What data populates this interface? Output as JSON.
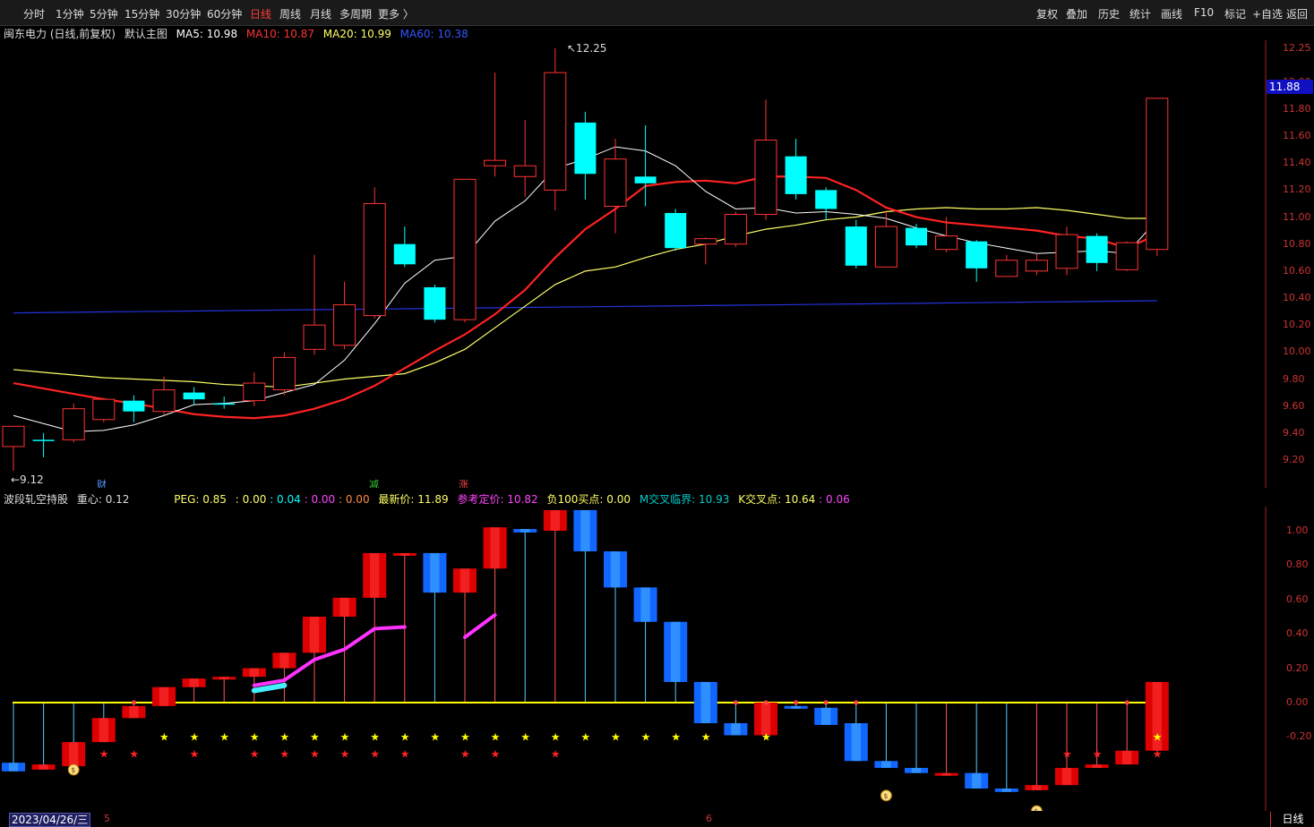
{
  "toolbar": {
    "left_items": [
      "分时",
      "1分钟",
      "5分钟",
      "15分钟",
      "30分钟",
      "60分钟",
      "日线",
      "周线",
      "月线",
      "多周期",
      "更多 〉"
    ],
    "active": "日线",
    "right_items": [
      "复权",
      "叠加",
      "历史",
      "统计",
      "画线",
      "F10",
      "标记",
      "+自选",
      "返回"
    ]
  },
  "main_header": {
    "stock": "闽东电力 (日线,前复权)",
    "template": "默认主图",
    "ma5": "MA5: 10.98",
    "ma10": "MA10: 10.87",
    "ma20": "MA20: 10.99",
    "ma60": "MA60: 10.38"
  },
  "main_axis": [
    "12.25",
    "12.00",
    "11.80",
    "11.60",
    "11.40",
    "11.20",
    "11.00",
    "10.80",
    "10.60",
    "10.40",
    "10.20",
    "10.00",
    "9.80",
    "9.60",
    "9.40",
    "9.20"
  ],
  "price_badge": "11.88",
  "high_label": "12.25",
  "low_label": "9.12",
  "event_marks": [
    "财",
    "减",
    "涨"
  ],
  "sub_header": {
    "name": "波段轧空持股",
    "center": "重心: 0.12",
    "peg": "PEG: 0.85",
    "v1": ": 0.00",
    "v2": ": 0.04",
    "v3": ": 0.00",
    "v4": ": 0.00",
    "latest": "最新价: 11.89",
    "ref": "参考定价: 10.82",
    "neg100": "负100买点: 0.00",
    "m_cross": "M交叉临界: 10.93",
    "k_cross": "K交叉点: 10.64",
    "k_cross2": ": 0.06"
  },
  "sub_axis": [
    "1.00",
    "0.80",
    "0.60",
    "0.40",
    "0.20",
    "0.00",
    "-0.20"
  ],
  "date_label": "2023/04/26/三",
  "month_ticks": [
    "5",
    "6"
  ],
  "period": "日线",
  "colors": {
    "up": "#ff3333",
    "down": "#00ffff",
    "ma5": "#ffffff",
    "ma10": "#ff2222",
    "ma20": "#ffff66",
    "ma60": "#3333ff",
    "accent": "#ff3b3b"
  },
  "chart_data": {
    "type": "candlestick",
    "ylim": [
      9.0,
      12.3
    ],
    "candles": [
      {
        "o": 9.3,
        "h": 9.38,
        "l": 9.12,
        "c": 9.45,
        "up": true
      },
      {
        "o": 9.35,
        "h": 9.4,
        "l": 9.22,
        "c": 9.35,
        "up": false
      },
      {
        "o": 9.35,
        "h": 9.62,
        "l": 9.33,
        "c": 9.58,
        "up": true
      },
      {
        "o": 9.5,
        "h": 9.66,
        "l": 9.48,
        "c": 9.65,
        "up": true
      },
      {
        "o": 9.64,
        "h": 9.68,
        "l": 9.48,
        "c": 9.56,
        "up": false
      },
      {
        "o": 9.56,
        "h": 9.82,
        "l": 9.54,
        "c": 9.72,
        "up": true
      },
      {
        "o": 9.7,
        "h": 9.74,
        "l": 9.61,
        "c": 9.65,
        "up": false
      },
      {
        "o": 9.62,
        "h": 9.67,
        "l": 9.58,
        "c": 9.62,
        "up": false
      },
      {
        "o": 9.64,
        "h": 9.85,
        "l": 9.6,
        "c": 9.77,
        "up": true
      },
      {
        "o": 9.72,
        "h": 10.0,
        "l": 9.68,
        "c": 9.96,
        "up": true
      },
      {
        "o": 10.02,
        "h": 10.72,
        "l": 9.98,
        "c": 10.2,
        "up": true
      },
      {
        "o": 10.05,
        "h": 10.52,
        "l": 10.02,
        "c": 10.35,
        "up": true
      },
      {
        "o": 10.27,
        "h": 11.22,
        "l": 10.25,
        "c": 11.1,
        "up": true
      },
      {
        "o": 10.8,
        "h": 10.93,
        "l": 10.63,
        "c": 10.65,
        "up": false
      },
      {
        "o": 10.48,
        "h": 10.5,
        "l": 10.22,
        "c": 10.24,
        "up": false
      },
      {
        "o": 10.24,
        "h": 11.28,
        "l": 10.22,
        "c": 11.28,
        "up": true
      },
      {
        "o": 11.38,
        "h": 12.07,
        "l": 11.3,
        "c": 11.42,
        "up": true
      },
      {
        "o": 11.3,
        "h": 11.72,
        "l": 11.15,
        "c": 11.38,
        "up": true
      },
      {
        "o": 11.2,
        "h": 12.25,
        "l": 11.05,
        "c": 12.07,
        "up": true
      },
      {
        "o": 11.7,
        "h": 11.78,
        "l": 11.13,
        "c": 11.32,
        "up": false
      },
      {
        "o": 11.08,
        "h": 11.58,
        "l": 10.88,
        "c": 11.43,
        "up": true
      },
      {
        "o": 11.3,
        "h": 11.68,
        "l": 11.08,
        "c": 11.25,
        "up": false
      },
      {
        "o": 11.03,
        "h": 11.06,
        "l": 10.75,
        "c": 10.77,
        "up": false
      },
      {
        "o": 10.8,
        "h": 10.85,
        "l": 10.65,
        "c": 10.84,
        "up": true
      },
      {
        "o": 10.8,
        "h": 11.04,
        "l": 10.78,
        "c": 11.02,
        "up": true
      },
      {
        "o": 11.02,
        "h": 11.87,
        "l": 10.98,
        "c": 11.57,
        "up": true
      },
      {
        "o": 11.45,
        "h": 11.58,
        "l": 11.13,
        "c": 11.17,
        "up": false
      },
      {
        "o": 11.2,
        "h": 11.22,
        "l": 10.98,
        "c": 11.06,
        "up": false
      },
      {
        "o": 10.93,
        "h": 10.98,
        "l": 10.62,
        "c": 10.64,
        "up": false
      },
      {
        "o": 10.63,
        "h": 11.05,
        "l": 10.63,
        "c": 10.93,
        "up": true
      },
      {
        "o": 10.92,
        "h": 10.95,
        "l": 10.77,
        "c": 10.79,
        "up": false
      },
      {
        "o": 10.76,
        "h": 11.0,
        "l": 10.74,
        "c": 10.86,
        "up": true
      },
      {
        "o": 10.82,
        "h": 10.83,
        "l": 10.52,
        "c": 10.62,
        "up": false
      },
      {
        "o": 10.56,
        "h": 10.72,
        "l": 10.56,
        "c": 10.68,
        "up": true
      },
      {
        "o": 10.6,
        "h": 10.73,
        "l": 10.57,
        "c": 10.68,
        "up": true
      },
      {
        "o": 10.62,
        "h": 10.93,
        "l": 10.57,
        "c": 10.87,
        "up": true
      },
      {
        "o": 10.86,
        "h": 10.88,
        "l": 10.6,
        "c": 10.66,
        "up": false
      },
      {
        "o": 10.61,
        "h": 10.82,
        "l": 10.6,
        "c": 10.81,
        "up": true
      },
      {
        "o": 10.76,
        "h": 11.88,
        "l": 10.71,
        "c": 11.88,
        "up": true
      }
    ],
    "ma5": [
      9.53,
      9.47,
      9.41,
      9.42,
      9.46,
      9.53,
      9.61,
      9.62,
      9.64,
      9.7,
      9.76,
      9.94,
      10.21,
      10.51,
      10.68,
      10.71,
      10.97,
      11.12,
      11.36,
      11.43,
      11.52,
      11.49,
      11.38,
      11.19,
      11.06,
      11.07,
      11.03,
      11.04,
      11.02,
      10.99,
      10.92,
      10.86,
      10.81,
      10.77,
      10.73,
      10.74,
      10.75,
      10.73,
      10.98
    ],
    "ma10": [
      9.77,
      9.73,
      9.69,
      9.65,
      9.62,
      9.58,
      9.54,
      9.52,
      9.51,
      9.53,
      9.58,
      9.65,
      9.75,
      9.88,
      10.01,
      10.13,
      10.28,
      10.46,
      10.7,
      10.91,
      11.06,
      11.23,
      11.26,
      11.27,
      11.25,
      11.3,
      11.3,
      11.29,
      11.2,
      11.07,
      11.0,
      10.96,
      10.94,
      10.92,
      10.9,
      10.86,
      10.84,
      10.77,
      10.87
    ],
    "ma20": [
      9.87,
      9.85,
      9.83,
      9.81,
      9.8,
      9.79,
      9.78,
      9.76,
      9.75,
      9.74,
      9.77,
      9.8,
      9.82,
      9.84,
      9.92,
      10.02,
      10.18,
      10.34,
      10.5,
      10.6,
      10.63,
      10.7,
      10.76,
      10.8,
      10.86,
      10.91,
      10.94,
      10.98,
      11.0,
      11.04,
      11.06,
      11.07,
      11.06,
      11.06,
      11.07,
      11.05,
      11.02,
      10.99,
      10.99
    ],
    "ma60_range": [
      10.29,
      10.38
    ],
    "sub": {
      "ylim": [
        -0.48,
        1.12
      ],
      "bars": [
        {
          "t": -0.35,
          "b": -0.4,
          "r": false
        },
        {
          "t": -0.36,
          "b": -0.39,
          "r": true
        },
        {
          "t": -0.23,
          "b": -0.37,
          "r": true
        },
        {
          "t": -0.09,
          "b": -0.23,
          "r": true
        },
        {
          "t": -0.02,
          "b": -0.09,
          "r": true
        },
        {
          "t": 0.09,
          "b": -0.02,
          "r": true
        },
        {
          "t": 0.14,
          "b": 0.09,
          "r": true
        },
        {
          "t": 0.15,
          "b": 0.14,
          "r": true
        },
        {
          "t": 0.2,
          "b": 0.15,
          "r": true
        },
        {
          "t": 0.29,
          "b": 0.2,
          "r": true
        },
        {
          "t": 0.5,
          "b": 0.29,
          "r": true
        },
        {
          "t": 0.61,
          "b": 0.5,
          "r": true
        },
        {
          "t": 0.87,
          "b": 0.61,
          "r": true
        },
        {
          "t": 0.87,
          "b": 0.87,
          "r": true
        },
        {
          "t": 0.87,
          "b": 0.64,
          "r": false
        },
        {
          "t": 0.78,
          "b": 0.64,
          "r": true
        },
        {
          "t": 1.02,
          "b": 0.78,
          "r": true
        },
        {
          "t": 1.01,
          "b": 0.99,
          "r": false
        },
        {
          "t": 1.12,
          "b": 1.0,
          "r": true
        },
        {
          "t": 1.12,
          "b": 0.88,
          "r": false
        },
        {
          "t": 0.88,
          "b": 0.67,
          "r": false
        },
        {
          "t": 0.67,
          "b": 0.47,
          "r": false
        },
        {
          "t": 0.47,
          "b": 0.12,
          "r": false
        },
        {
          "t": 0.12,
          "b": -0.12,
          "r": false
        },
        {
          "t": -0.12,
          "b": -0.19,
          "r": false
        },
        {
          "t": 0.0,
          "b": -0.19,
          "r": true
        },
        {
          "t": -0.02,
          "b": -0.03,
          "r": false
        },
        {
          "t": -0.03,
          "b": -0.13,
          "r": false
        },
        {
          "t": -0.12,
          "b": -0.34,
          "r": false
        },
        {
          "t": -0.34,
          "b": -0.38,
          "r": false
        },
        {
          "t": -0.38,
          "b": -0.41,
          "r": false
        },
        {
          "t": -0.41,
          "b": -0.41,
          "r": true
        },
        {
          "t": -0.41,
          "b": -0.5,
          "r": false
        },
        {
          "t": -0.5,
          "b": -0.52,
          "r": false
        },
        {
          "t": -0.48,
          "b": -0.51,
          "r": true
        },
        {
          "t": -0.38,
          "b": -0.48,
          "r": true
        },
        {
          "t": -0.36,
          "b": -0.38,
          "r": true
        },
        {
          "t": -0.28,
          "b": -0.36,
          "r": true
        },
        {
          "t": 0.12,
          "b": -0.28,
          "r": true
        }
      ]
    }
  }
}
